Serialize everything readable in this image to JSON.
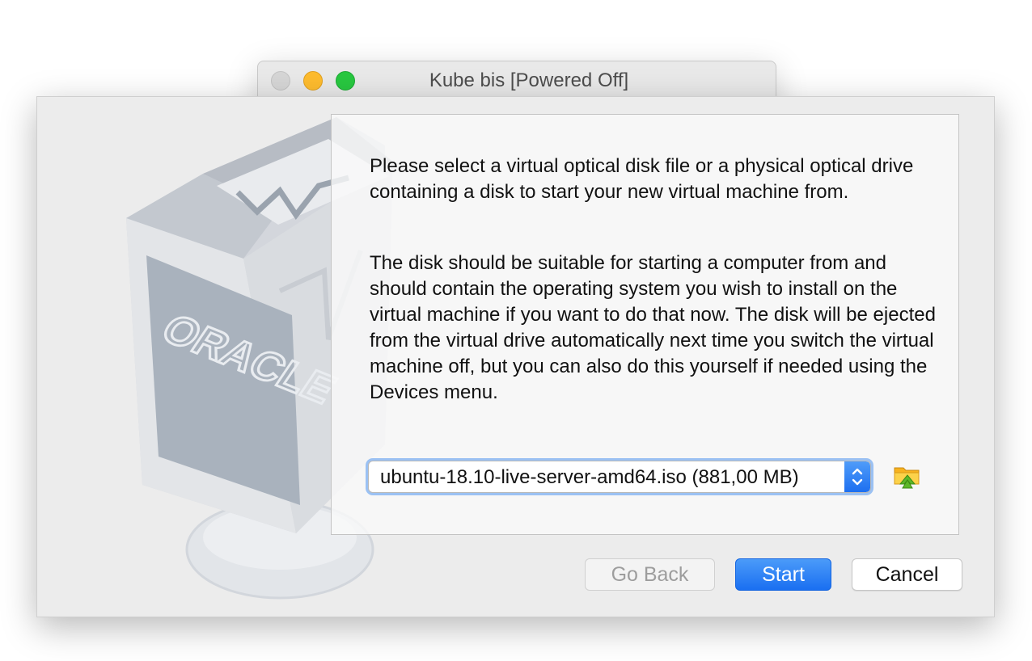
{
  "window": {
    "title": "Kube bis [Powered Off]"
  },
  "dialog": {
    "paragraph_1": "Please select a virtual optical disk file or a physical optical drive containing a disk to start your new virtual machine from.",
    "paragraph_2": "The disk should be suitable for starting a computer from and should contain the operating system you wish to install on the virtual machine if you want to do that now. The disk will be ejected from the virtual drive automatically next time you switch the virtual machine off, but you can also do this yourself if needed using the Devices menu.",
    "disk_selector": {
      "value": "ubuntu-18.10-live-server-amd64.iso (881,00 MB)"
    },
    "folder_icon": "folder-open-icon",
    "watermark_text": "ORACLE"
  },
  "buttons": {
    "back": "Go Back",
    "start": "Start",
    "cancel": "Cancel"
  },
  "colors": {
    "accent": "#1d6ff0",
    "disabled_text": "#9d9d9d"
  }
}
